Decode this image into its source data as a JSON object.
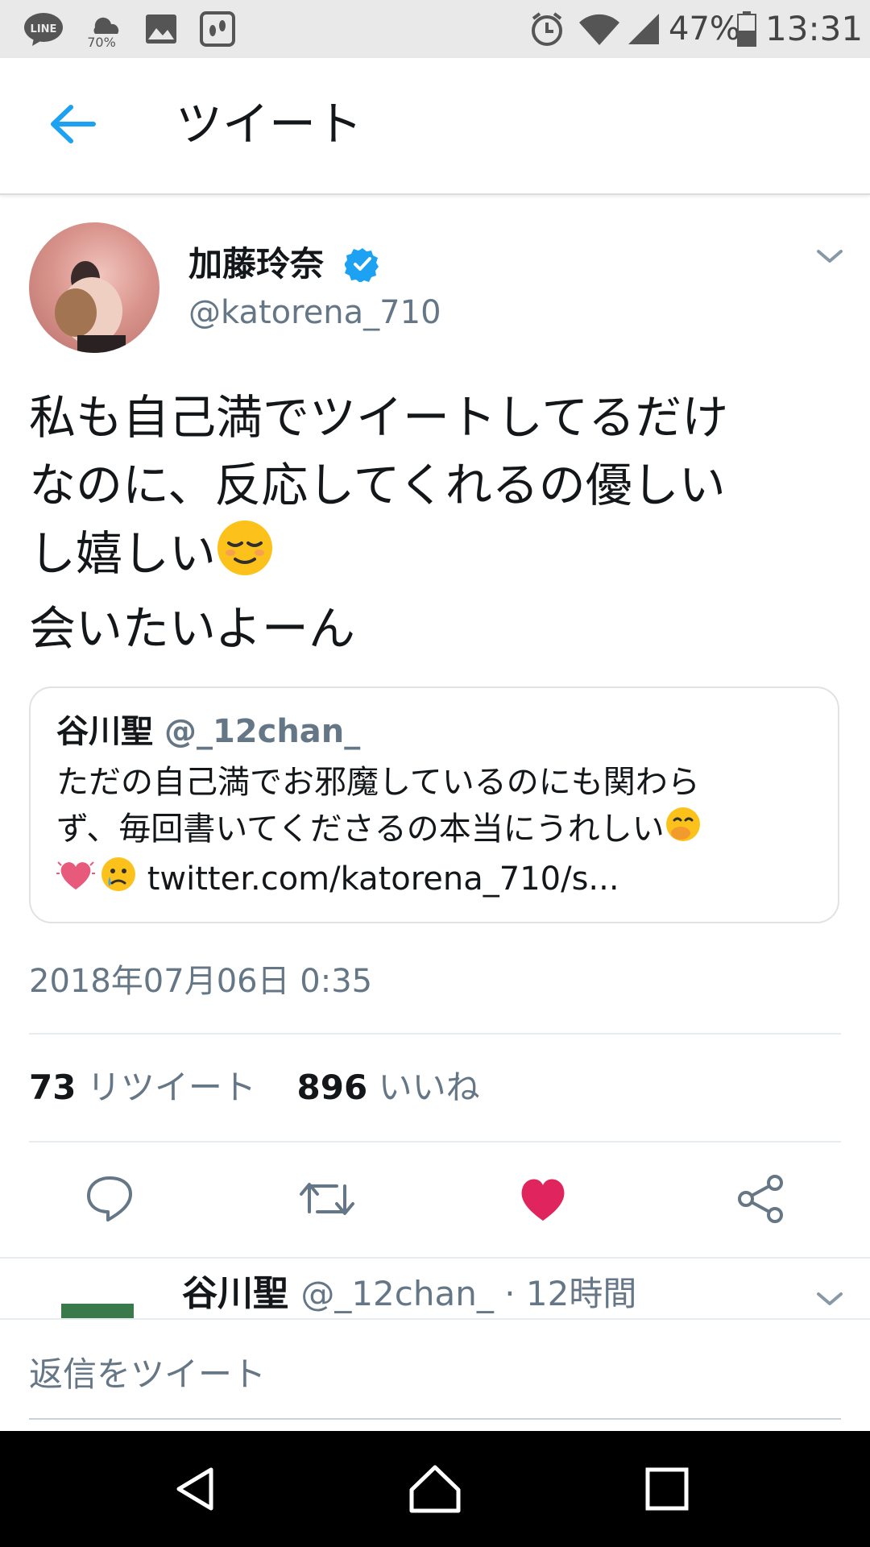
{
  "status_bar": {
    "battery": "47%",
    "time": "13:31",
    "weather_badge": "70%",
    "line_label": "LINE"
  },
  "app_bar": {
    "title": "ツイート"
  },
  "tweet": {
    "display_name": "加藤玲奈",
    "handle": "@katorena_710",
    "text_line1": "私も自己満でツイートしてるだけ",
    "text_line2": "なのに、反応してくれるの優しい",
    "text_line3": "し嬉しい",
    "text_line4": "会いたいよーん",
    "timestamp": "2018年07月06日 0:35"
  },
  "quote": {
    "name": "谷川聖",
    "handle": "@_12chan_",
    "text_line1": "ただの自己満でお邪魔しているのにも関わら",
    "text_line2": "ず、毎回書いてくださるの本当にうれしい",
    "text_line3_link": "twitter.com/katorena_710/s..."
  },
  "stats": {
    "retweets": "73",
    "retweets_label": "リツイート",
    "likes": "896",
    "likes_label": "いいね"
  },
  "reply_preview": {
    "name": "谷川聖",
    "meta": "@_12chan_ · 12時間"
  },
  "reply_input": {
    "placeholder": "返信をツイート"
  },
  "colors": {
    "accent": "#1da1f2",
    "like": "#e0245e",
    "secondary_text": "#657786"
  }
}
